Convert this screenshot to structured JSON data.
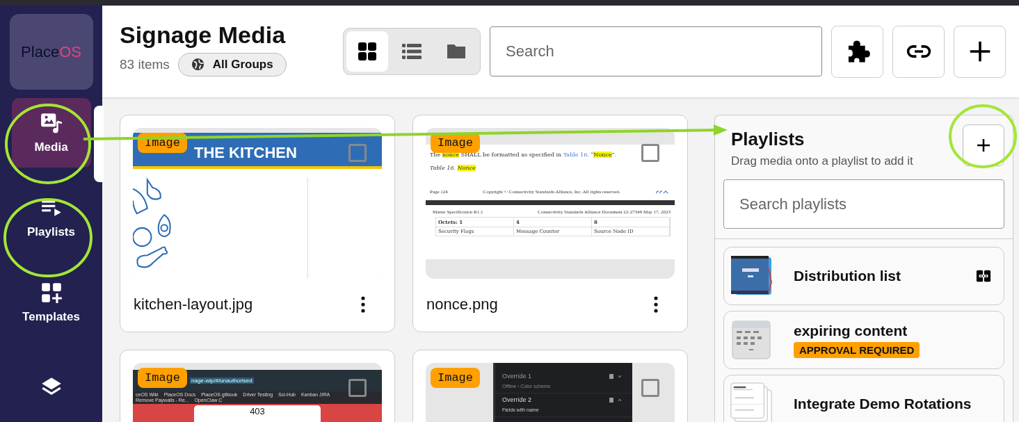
{
  "sidebar": {
    "logo": {
      "part_1": "Place",
      "part_2": "OS"
    },
    "items": [
      {
        "label": "Media",
        "selected": true
      },
      {
        "label": "Playlists",
        "selected": false
      },
      {
        "label": "Templates",
        "selected": false
      },
      {
        "selected": false
      }
    ]
  },
  "header": {
    "title": "Signage Media",
    "count": "83 items",
    "group_button": "All Groups",
    "views": [
      {
        "selected": true
      },
      {
        "selected": false
      },
      {
        "selected": false
      }
    ],
    "search": {
      "placeholder": "Search"
    }
  },
  "media": [
    {
      "name": "kitchen-layout.jpg",
      "badge": "Image",
      "checked": false,
      "thumb": {
        "kind": "kitchen",
        "heading": "THE KITCHEN"
      }
    },
    {
      "name": "nonce.png",
      "badge": "Image",
      "checked": false,
      "thumb": {
        "kind": "document",
        "line": [
          {
            "text": "The ",
            "kind": "plain"
          },
          {
            "text": "nonce",
            "kind": "highlight"
          },
          {
            "text": " SHALL be formatted as specified in ",
            "kind": "plain"
          },
          {
            "text": "Table 16,",
            "kind": "link"
          },
          {
            "text": " “",
            "kind": "plain"
          },
          {
            "text": "Nonce",
            "kind": "highlight"
          },
          {
            "text": "”.",
            "kind": "plain"
          }
        ],
        "caption": [
          {
            "text": "Table 16. ",
            "kind": "plain"
          },
          {
            "text": "Nonce",
            "kind": "highlight"
          }
        ],
        "page": "Page 124",
        "copyright": "Copyright © Connectivity Standards Alliance, Inc. All rights reserved.",
        "spec": "Matter Specification R1.1",
        "doc": "Connectivity Standards Alliance Document 22-27349 May 17, 2023",
        "table": [
          [
            "Octets: 1",
            "4",
            "8"
          ],
          [
            "Security Flags",
            "Message Counter",
            "Source Node ID"
          ]
        ]
      }
    },
    {
      "badge": "Image",
      "checked": false,
      "thumb": {
        "kind": "browser",
        "url": "nage-wip/#/unauthorised",
        "bookmarks": [
          "ceOS Wiki",
          "PlaceOS Docs",
          "PlaceOS gitbook",
          "Driver Testing",
          "Sci-Hub",
          "Kanban JIRA",
          "Remove Paywalls - Re...",
          "OpenClaw C"
        ],
        "code": "403"
      }
    },
    {
      "badge": "Image",
      "checked": false,
      "thumb": {
        "kind": "dark-panel",
        "rows": [
          {
            "title": "Override 1",
            "sub": "Offline › Color scheme",
            "expanded": false
          },
          {
            "title": "Override 2",
            "sub": "Fields with name",
            "expanded": true
          }
        ]
      }
    }
  ],
  "playlists": {
    "title": "Playlists",
    "subtitle": "Drag media onto a playlist to add it",
    "search": {
      "placeholder": "Search playlists"
    },
    "items": [
      {
        "name": "Distribution list",
        "shared": true,
        "thumb": {
          "kind": "blue"
        }
      },
      {
        "name": "expiring content",
        "tag": "APPROVAL REQUIRED",
        "shared": false,
        "thumb": {
          "kind": "grey"
        }
      },
      {
        "name": "Integrate Demo Rotations",
        "shared": false,
        "thumb": {
          "kind": "cards"
        }
      }
    ]
  }
}
